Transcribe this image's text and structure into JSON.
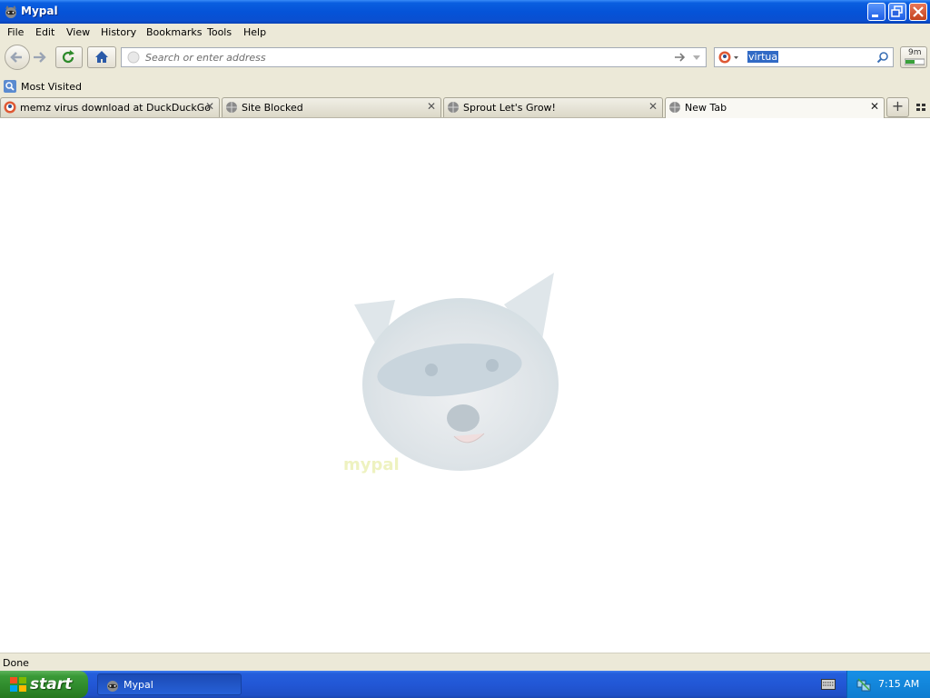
{
  "window": {
    "title": "Mypal"
  },
  "menu": [
    "File",
    "Edit",
    "View",
    "History",
    "Bookmarks",
    "Tools",
    "Help"
  ],
  "toolbar": {
    "address_placeholder": "Search or enter address",
    "search_value": "virtua",
    "addon_label": "9m"
  },
  "bookmarks": {
    "most_visited": "Most Visited"
  },
  "tabs": [
    {
      "label": "memz virus download at DuckDuckGo",
      "active": false
    },
    {
      "label": "Site Blocked",
      "active": false
    },
    {
      "label": "Sprout Let's Grow!",
      "active": false
    },
    {
      "label": "New Tab",
      "active": true
    }
  ],
  "content": {
    "watermark_text": "mypal"
  },
  "status": {
    "text": "Done"
  },
  "taskbar": {
    "start_label": "start",
    "task_label": "Mypal",
    "clock": "7:15 AM"
  },
  "colors": {
    "titlebar": "#0553d8",
    "taskbar": "#245edb",
    "start": "#3a9a37",
    "selection": "#316ac5"
  }
}
